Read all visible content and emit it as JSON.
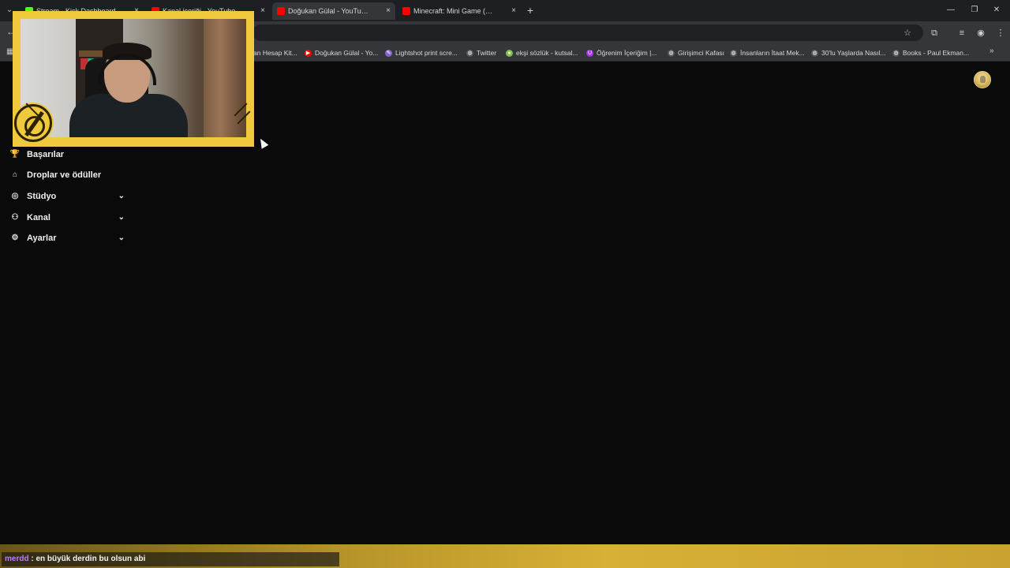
{
  "tabs": [
    {
      "title": "Stream - Kick Dashboard",
      "favicon_color": "#53fc18",
      "active": false
    },
    {
      "title": "Kanal içeriği - YouTube Studio",
      "favicon_color": "#ff0000",
      "active": false
    },
    {
      "title": "Doğukan Gülal - YouTube",
      "favicon_color": "#ff0000",
      "active": true
    },
    {
      "title": "Minecraft: Mini Game (Hide&Seek)",
      "favicon_color": "#ff0000",
      "active": false
    }
  ],
  "tab_close_glyph": "×",
  "new_tab_glyph": "+",
  "bookmarks": [
    {
      "label": "an Hesap Kit...",
      "icon": "globe-icon",
      "color": "#555555"
    },
    {
      "label": "Doğukan Gülal - Yo...",
      "icon": "youtube-icon",
      "color": "#ff0000"
    },
    {
      "label": "Lightshot print scre...",
      "icon": "feather-icon",
      "color": "#8a63d2"
    },
    {
      "label": "Twitter",
      "icon": "globe-icon",
      "color": "#555555"
    },
    {
      "label": "ekşi sözlük - kutsal...",
      "icon": "leaf-icon",
      "color": "#81c14b"
    },
    {
      "label": "Öğrenim İçeriğim |...",
      "icon": "udemy-icon",
      "color": "#a435f0"
    },
    {
      "label": "Girişimci Kafası",
      "icon": "globe-icon",
      "color": "#555555"
    },
    {
      "label": "İnsanların İtaat Mek...",
      "icon": "globe-icon",
      "color": "#555555"
    },
    {
      "label": "30'lu Yaşlarda Nasıl...",
      "icon": "globe-icon",
      "color": "#555555"
    },
    {
      "label": "Books - Paul Ekman...",
      "icon": "globe-icon",
      "color": "#555555"
    }
  ],
  "sidebar": [
    {
      "label": "Başarılar",
      "icon": "trophy-icon",
      "expandable": false
    },
    {
      "label": "Droplar ve ödüller",
      "icon": "gift-icon",
      "expandable": false
    },
    {
      "label": "Stüdyo",
      "icon": "studio-icon",
      "expandable": true
    },
    {
      "label": "Kanal",
      "icon": "channel-icon",
      "expandable": true
    },
    {
      "label": "Ayarlar",
      "icon": "gear-icon",
      "expandable": true
    }
  ],
  "chat": {
    "username": "merdd",
    "separator": " : ",
    "message": "en büyük derdin bu olsun abi",
    "username_color": "#b77dff"
  },
  "colors": {
    "overlay_accent": "#f0c93c",
    "page_bg": "#0a0a0a",
    "toolbar_bg": "#35363a"
  }
}
